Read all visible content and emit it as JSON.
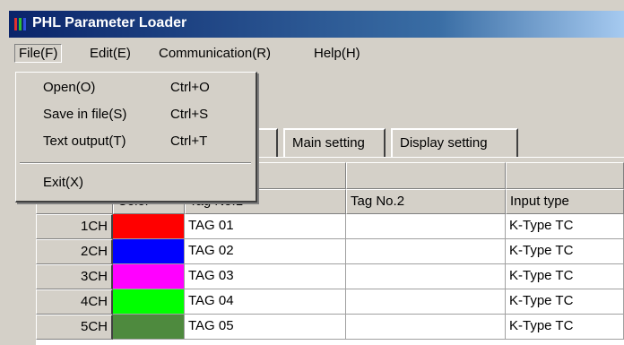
{
  "window": {
    "title": "PHL Parameter Loader"
  },
  "menubar": {
    "items": [
      {
        "label": "File(F)",
        "left": 0
      },
      {
        "label": "Edit(E)"
      },
      {
        "label": "Communication(R)"
      },
      {
        "label": "Help(H)"
      }
    ]
  },
  "file_menu": {
    "items": [
      {
        "label": "Open(O)",
        "shortcut": "Ctrl+O"
      },
      {
        "label": "Save in file(S)",
        "shortcut": "Ctrl+S"
      },
      {
        "label": "Text output(T)",
        "shortcut": "Ctrl+T"
      },
      {
        "label": "Exit(X)",
        "shortcut": ""
      }
    ]
  },
  "tabs": [
    {
      "label": "g"
    },
    {
      "label": "Main setting"
    },
    {
      "label": "Display setting"
    }
  ],
  "grid": {
    "headers": {
      "color": "Color",
      "tag1": "Tag No.1",
      "tag2": "Tag No.2",
      "input_type": "Input type"
    },
    "rows": [
      {
        "ch": "1CH",
        "color": "#ff0000",
        "tag1": "TAG 01",
        "tag2": "",
        "input_type": "K-Type TC"
      },
      {
        "ch": "2CH",
        "color": "#0000ff",
        "tag1": "TAG 02",
        "tag2": "",
        "input_type": "K-Type TC"
      },
      {
        "ch": "3CH",
        "color": "#ff00ff",
        "tag1": "TAG 03",
        "tag2": "",
        "input_type": "K-Type TC"
      },
      {
        "ch": "4CH",
        "color": "#00ff00",
        "tag1": "TAG 04",
        "tag2": "",
        "input_type": "K-Type TC"
      },
      {
        "ch": "5CH",
        "color": "#4e8a3e",
        "tag1": "TAG 05",
        "tag2": "",
        "input_type": "K-Type TC"
      }
    ]
  },
  "colors": {
    "titlebar_start": "#0a246a",
    "titlebar_end": "#a6caf0",
    "face": "#d4d0c8"
  }
}
